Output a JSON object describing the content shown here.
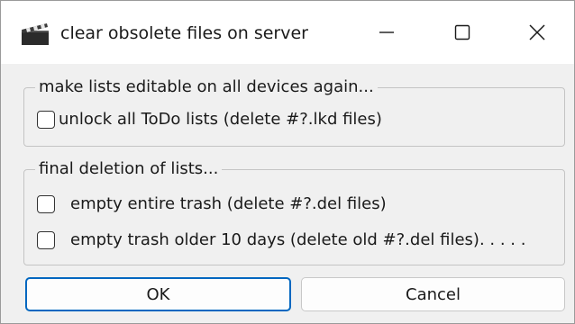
{
  "window": {
    "title": "clear obsolete files on server",
    "icons": {
      "app": "clapperboard-icon",
      "minimize": "minimize-icon",
      "maximize": "maximize-icon",
      "close": "close-icon"
    }
  },
  "group_unlock": {
    "legend": "make lists editable on all devices again...",
    "options": [
      {
        "label": "unlock all ToDo lists (delete #?.lkd files)",
        "checked": false
      }
    ]
  },
  "group_delete": {
    "legend": "final deletion of lists...",
    "options": [
      {
        "label": "empty entire trash (delete #?.del files)",
        "checked": false
      },
      {
        "label": "empty trash older 10 days (delete old #?.del files). . . . .",
        "checked": false
      }
    ]
  },
  "buttons": {
    "ok": "OK",
    "cancel": "Cancel"
  },
  "colors": {
    "focus_border": "#0067c0",
    "window_bg": "#f0f0f0",
    "titlebar_bg": "#ffffff"
  }
}
